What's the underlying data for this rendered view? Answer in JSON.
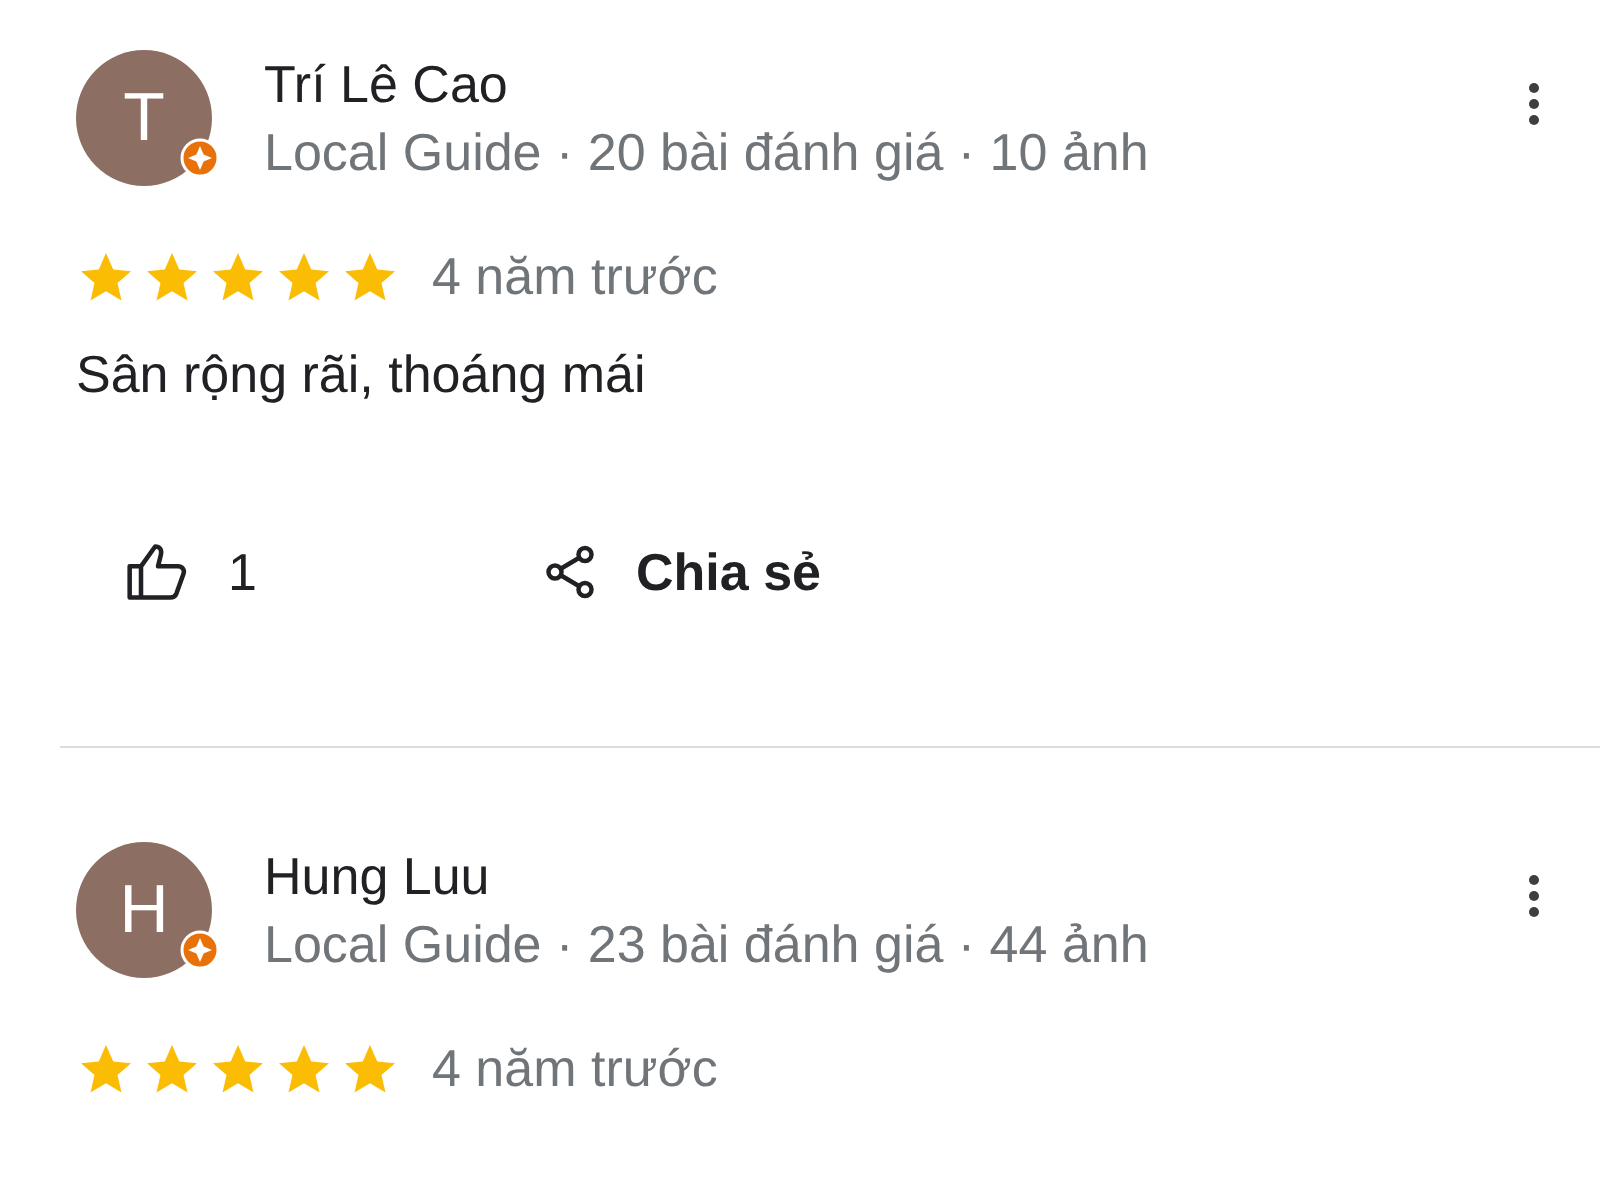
{
  "reviews": [
    {
      "avatar_letter": "T",
      "name": "Trí Lê Cao",
      "meta": "Local Guide · 20 bài đánh giá · 10 ảnh",
      "stars": 5,
      "time": "4 năm trước",
      "text": "Sân rộng rãi, thoáng mái",
      "likes": "1",
      "share": "Chia sẻ"
    },
    {
      "avatar_letter": "H",
      "name": "Hung Luu",
      "meta": "Local Guide · 23 bài đánh giá · 44 ảnh",
      "stars": 5,
      "time": "4 năm trước"
    }
  ]
}
